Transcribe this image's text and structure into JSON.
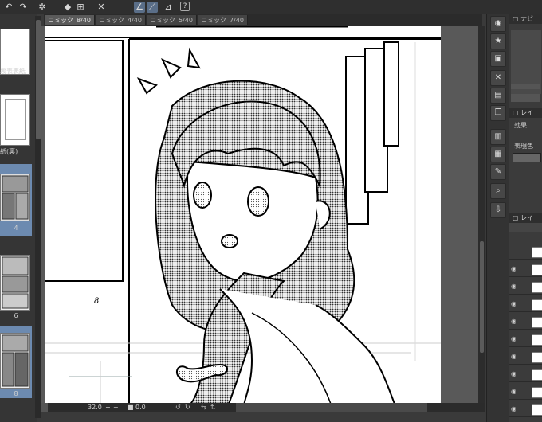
{
  "toolbar": {
    "icons": [
      "undo-icon",
      "redo-icon",
      "loading-icon",
      "fill-icon",
      "transform-icon",
      "pen-icon",
      "line-icon",
      "ruler-icon",
      "help-icon"
    ],
    "help_label": "?"
  },
  "tabs": [
    {
      "label": "コミック",
      "count": "8/40",
      "active": true
    },
    {
      "label": "コミック",
      "count": "4/40",
      "active": false
    },
    {
      "label": "コミック",
      "count": "5/40",
      "active": false
    },
    {
      "label": "コミック",
      "count": "7/40",
      "active": false
    }
  ],
  "left_pages": {
    "labels": [
      "裏表表紙",
      "紙(裏)",
      "4",
      "6",
      "8"
    ],
    "page_number": "8"
  },
  "canvas": {
    "page_number": "8"
  },
  "statusbar": {
    "zoom": "32.0",
    "rotation": "0.0"
  },
  "right_panel": {
    "nav_label": "ナビ",
    "layer_label": "レイ",
    "effect_label": "効果",
    "expression_label": "表現色",
    "layer_tab_label": "レイ"
  },
  "colors": {
    "accent": "#5a6e88",
    "selection": "#6c8ab0"
  }
}
